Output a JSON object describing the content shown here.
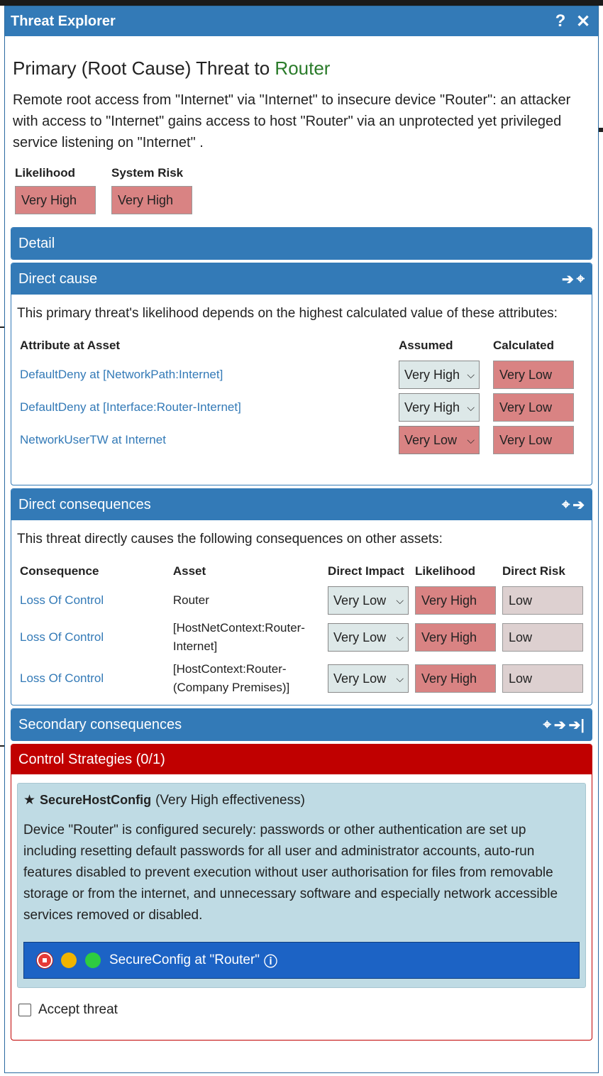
{
  "window": {
    "title": "Threat Explorer",
    "help_icon": "question-icon",
    "close_icon": "close-icon"
  },
  "threat": {
    "heading_prefix": "Primary (Root Cause) Threat to ",
    "asset": "Router",
    "description": "Remote root access from \"Internet\" via \"Internet\" to insecure device \"Router\": an attacker with access to \"Internet\" gains access to host \"Router\" via an unprotected yet privileged service listening on \"Internet\" .",
    "likelihood_label": "Likelihood",
    "likelihood_value": "Very High",
    "risk_label": "System Risk",
    "risk_value": "Very High"
  },
  "detail": {
    "title": "Detail"
  },
  "direct_cause": {
    "title": "Direct cause",
    "intro": "This primary threat's likelihood depends on the highest calculated value of these attributes:",
    "columns": [
      "Attribute at Asset",
      "Assumed",
      "Calculated"
    ],
    "rows": [
      {
        "attribute": "DefaultDeny at [NetworkPath:Internet]",
        "assumed": "Very High",
        "calculated": "Very Low"
      },
      {
        "attribute": "DefaultDeny at [Interface:Router-Internet]",
        "assumed": "Very High",
        "calculated": "Very Low"
      },
      {
        "attribute": "NetworkUserTW at Internet",
        "assumed": "Very Low",
        "calculated": "Very Low"
      }
    ]
  },
  "direct_consequences": {
    "title": "Direct consequences",
    "intro": "This threat directly causes the following consequences on other assets:",
    "columns": [
      "Consequence",
      "Asset",
      "Direct Impact",
      "Likelihood",
      "Direct Risk"
    ],
    "rows": [
      {
        "consequence": "Loss Of Control",
        "asset": "Router",
        "impact": "Very Low",
        "likelihood": "Very High",
        "risk": "Low"
      },
      {
        "consequence": "Loss Of Control",
        "asset": "[HostNetContext:Router-Internet]",
        "impact": "Very Low",
        "likelihood": "Very High",
        "risk": "Low"
      },
      {
        "consequence": "Loss Of Control",
        "asset": "[HostContext:Router-(Company Premises)]",
        "impact": "Very Low",
        "likelihood": "Very High",
        "risk": "Low"
      }
    ]
  },
  "secondary_consequences": {
    "title": "Secondary consequences"
  },
  "control_strategies": {
    "title": "Control Strategies (0/1)",
    "strategy_name": "SecureHostConfig",
    "effectiveness": "(Very High effectiveness)",
    "description": "Device \"Router\" is configured securely: passwords or other authentication are set up including resetting default passwords for all user and administrator accounts, auto-run features disabled to prevent execution without user authorisation for files from removable storage or from the internet, and unnecessary software and especially network accessible services removed or disabled.",
    "control_label": "SecureConfig at \"Router\"",
    "accept_label": "Accept threat",
    "colors": {
      "red": "#e53935",
      "amber": "#f0b400",
      "green": "#2ecc40"
    }
  }
}
